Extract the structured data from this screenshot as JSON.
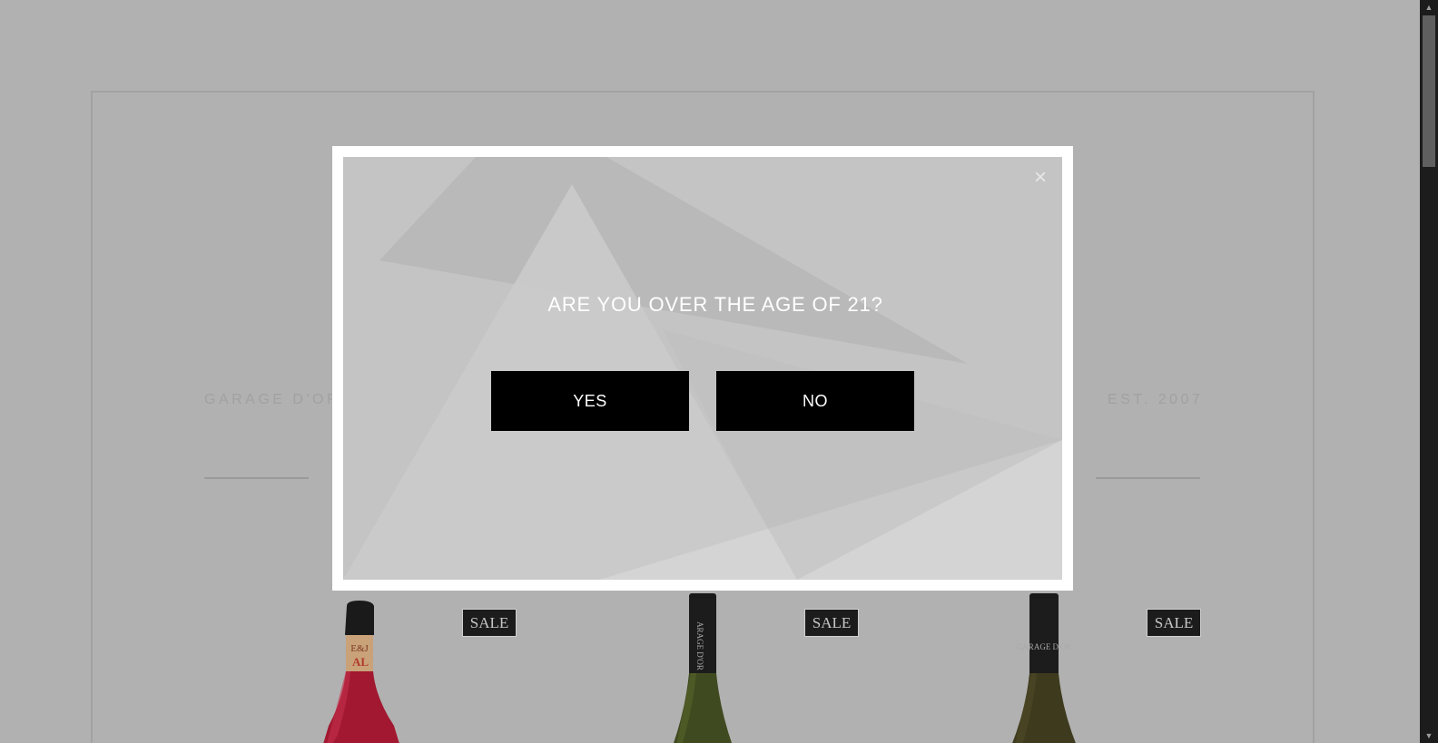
{
  "background": {
    "brand_left": "GARAGE D'OR",
    "brand_right": "EST. 2007",
    "products": [
      {
        "badge": "SALE",
        "label_fragment": "AL"
      },
      {
        "badge": "SALE",
        "label_fragment": "ARAGE D'OR"
      },
      {
        "badge": "SALE",
        "label_fragment": "GARAGE D'OR"
      }
    ]
  },
  "modal": {
    "question": "ARE YOU OVER THE AGE OF 21?",
    "yes_label": "YES",
    "no_label": "NO",
    "close_icon": "close-icon",
    "close_glyph": "×"
  },
  "scrollbar": {
    "up_glyph": "▲",
    "down_glyph": "▼"
  },
  "colors": {
    "overlay": "#b1b1b1",
    "modal_border": "#ffffff",
    "modal_panel": "#c4c4c4",
    "button": "#000000",
    "button_text": "#ffffff",
    "badge": "#1c1c1c"
  }
}
